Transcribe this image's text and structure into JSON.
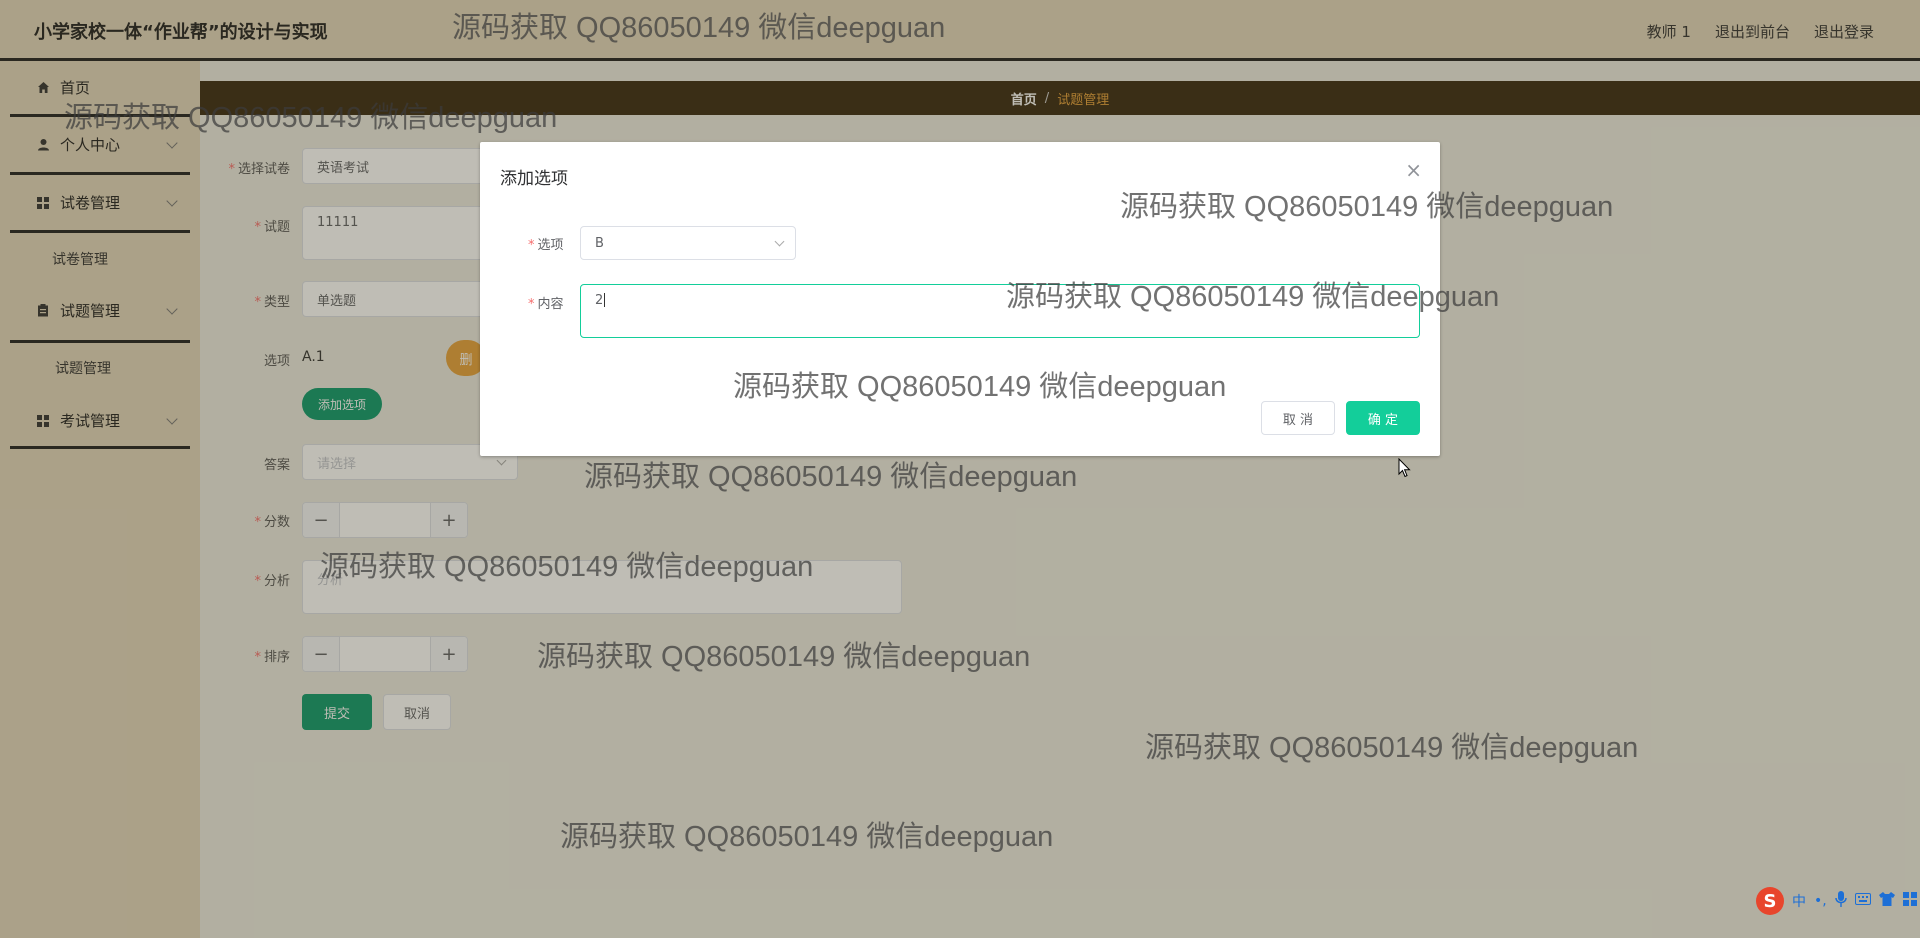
{
  "header": {
    "title": "小学家校一体“作业帮”的设计与实现",
    "links": [
      "教师 1",
      "退出到前台",
      "退出登录"
    ]
  },
  "sidebar": {
    "items": [
      {
        "label": "首页",
        "icon": "home-icon"
      },
      {
        "label": "个人中心",
        "icon": "user-icon"
      },
      {
        "label": "试卷管理",
        "icon": "grid-icon"
      },
      {
        "label": "试卷管理",
        "icon": ""
      },
      {
        "label": "试题管理",
        "icon": "clipboard-icon"
      },
      {
        "label": "试题管理",
        "icon": ""
      },
      {
        "label": "考试管理",
        "icon": "grid-icon"
      }
    ]
  },
  "breadcrumb": {
    "home": "首页",
    "separator": "/",
    "current": "试题管理"
  },
  "form": {
    "paper_label": "选择试卷",
    "paper_value": "英语考试",
    "question_label": "试题",
    "question_value": "11111",
    "type_label": "类型",
    "type_value": "单选题",
    "options_label": "选项",
    "option_a": "A.1",
    "delete_label": "删",
    "add_option_label": "添加选项",
    "answer_label": "答案",
    "answer_placeholder": "请选择",
    "score_label": "分数",
    "minus": "−",
    "plus": "+",
    "analysis_label": "分析",
    "analysis_placeholder": "分析",
    "sort_label": "排序",
    "submit_label": "提交",
    "cancel_label": "取消"
  },
  "dialog": {
    "title": "添加选项",
    "close": "×",
    "option_label": "选项",
    "option_value": "B",
    "content_label": "内容",
    "content_value": "2",
    "cancel_label": "取 消",
    "confirm_label": "确 定"
  },
  "watermark": "源码获取 QQ86050149 微信deepguan",
  "ime": {
    "logo": "S",
    "lang": "中",
    "punct": "•,"
  },
  "colors": {
    "primary": "#13ce9a",
    "breadcrumb_bg": "#3a2a12",
    "accent": "#e6a23c",
    "header_bg": "#e2d5bd"
  }
}
